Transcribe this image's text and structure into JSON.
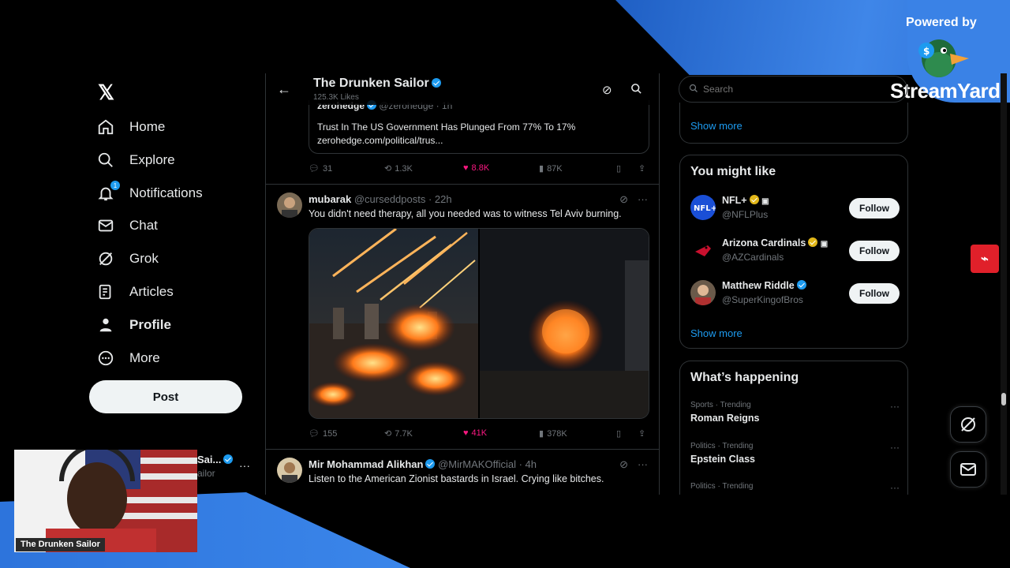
{
  "overlay": {
    "powered_by": "Powered by",
    "brand": "StreamYard",
    "webcam_label": "The Drunken Sailor"
  },
  "nav": {
    "items": [
      {
        "label": "Home",
        "icon": "home-icon"
      },
      {
        "label": "Explore",
        "icon": "search-icon"
      },
      {
        "label": "Notifications",
        "icon": "bell-icon",
        "badge": "1"
      },
      {
        "label": "Chat",
        "icon": "mail-icon"
      },
      {
        "label": "Grok",
        "icon": "grok-icon"
      },
      {
        "label": "Articles",
        "icon": "articles-icon"
      },
      {
        "label": "Profile",
        "icon": "person-icon"
      },
      {
        "label": "More",
        "icon": "more-circle-icon"
      }
    ],
    "post_label": "Post",
    "account_name_partial": "Sai...",
    "account_handle_partial": "ailor"
  },
  "feed": {
    "header_title": "The Drunken Sailor",
    "header_sub": "125.3K Likes",
    "quote": {
      "author": "zerohedge",
      "handle": "@zerohedge · 1h",
      "text": "Trust In The US Government Has Plunged From 77% To 17%",
      "link": "zerohedge.com/political/trus..."
    },
    "tweet0_actions": {
      "replies": "31",
      "reposts": "1.3K",
      "likes": "8.8K",
      "views": "87K"
    },
    "tweet1": {
      "name": "mubarak",
      "handle": "@curseddposts · 22h",
      "text": "You didn't need therapy, all you needed was to witness Tel Aviv burning.",
      "actions": {
        "replies": "155",
        "reposts": "7.7K",
        "likes": "41K",
        "views": "378K"
      }
    },
    "tweet2": {
      "name": "Mir Mohammad Alikhan",
      "handle": "@MirMAKOfficial · 4h",
      "text": "Listen to the American Zionist bastards in Israel. Crying like bitches."
    }
  },
  "sidebar": {
    "search_placeholder": "Search",
    "show_more_top": "Show more",
    "you_might_like": {
      "title": "You might like",
      "accounts": [
        {
          "name": "NFL+",
          "handle": "@NFLPlus",
          "follow": "Follow"
        },
        {
          "name": "Arizona Cardinals",
          "handle": "@AZCardinals",
          "follow": "Follow"
        },
        {
          "name": "Matthew Riddle",
          "handle": "@SuperKingofBros",
          "follow": "Follow"
        }
      ],
      "show_more": "Show more"
    },
    "whats_happening": {
      "title": "What’s happening",
      "trends": [
        {
          "meta": "Sports · Trending",
          "name": "Roman Reigns"
        },
        {
          "meta": "Politics · Trending",
          "name": "Epstein Class"
        },
        {
          "meta": "Politics · Trending",
          "name": ""
        }
      ]
    }
  },
  "colors": {
    "accent": "#1d9bf0",
    "like": "#f91880",
    "streamyard_blue": "#3a82e6"
  }
}
